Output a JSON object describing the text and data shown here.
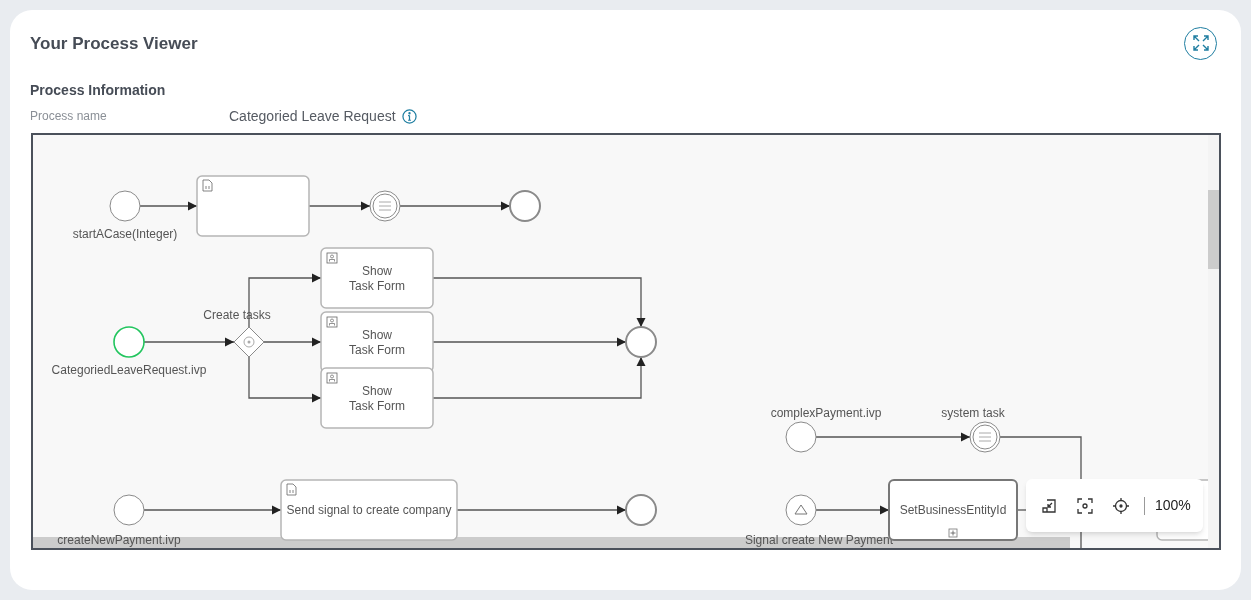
{
  "header": {
    "title": "Your Process Viewer"
  },
  "info": {
    "heading": "Process Information",
    "field_label": "Process name",
    "field_value": "Categoried Leave Request"
  },
  "diagram": {
    "nodes": [
      {
        "kind": "start",
        "label": "startACase(Integer)",
        "highlighted": false
      },
      {
        "kind": "script_task",
        "highlighted": false
      },
      {
        "kind": "intermediate",
        "highlighted": false
      },
      {
        "kind": "end",
        "highlighted": false
      },
      {
        "kind": "start",
        "label": "CategoriedLeaveRequest.ivp",
        "highlighted": true
      },
      {
        "kind": "gateway",
        "label": "Create tasks",
        "highlighted": false
      },
      {
        "kind": "user_task",
        "label": "Show Task Form",
        "highlighted": false
      },
      {
        "kind": "user_task",
        "label": "Show Task Form",
        "highlighted": false
      },
      {
        "kind": "user_task",
        "label": "Show Task Form",
        "highlighted": false
      },
      {
        "kind": "end",
        "highlighted": false
      },
      {
        "kind": "start",
        "label": "complexPayment.ivp",
        "highlighted": false
      },
      {
        "kind": "intermediate",
        "label": "system task",
        "highlighted": false
      },
      {
        "kind": "start",
        "label": "createNewPayment.ivp",
        "highlighted": false
      },
      {
        "kind": "script_task",
        "label": "Send signal to create company",
        "highlighted": false
      },
      {
        "kind": "end",
        "highlighted": false
      },
      {
        "kind": "signal_start",
        "label": "Signal create New Payment",
        "highlighted": false
      },
      {
        "kind": "subprocess",
        "label": "SetBusinessEntityId",
        "highlighted": false
      },
      {
        "kind": "task",
        "highlighted": false
      }
    ]
  },
  "toolbar": {
    "zoom": "100%"
  }
}
